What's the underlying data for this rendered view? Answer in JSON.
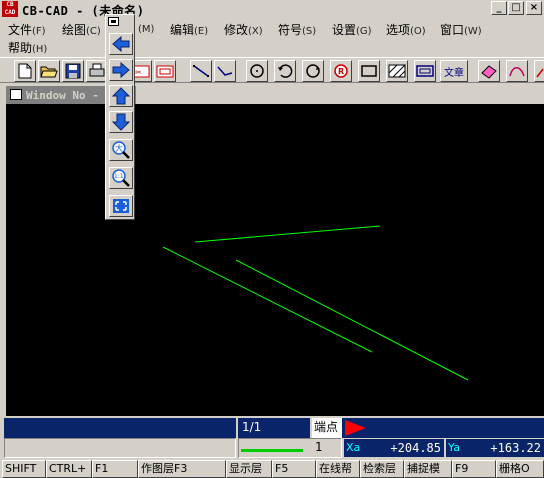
{
  "window": {
    "app_icon_text": "CB CAD",
    "title": "CB-CAD - (未命名)",
    "minimize": "_",
    "maximize": "□",
    "close": "×"
  },
  "menu": {
    "items": [
      {
        "label": "文件",
        "accel": "(F)"
      },
      {
        "label": "绘图",
        "accel": "(C)"
      },
      {
        "label": "",
        "accel": "(M)"
      },
      {
        "label": "编辑",
        "accel": "(E)"
      },
      {
        "label": "修改",
        "accel": "(X)"
      },
      {
        "label": "符号",
        "accel": "(S)"
      },
      {
        "label": "设置",
        "accel": "(G)"
      },
      {
        "label": "选项",
        "accel": "(O)"
      },
      {
        "label": "窗口",
        "accel": "(W)"
      }
    ],
    "help": {
      "label": "帮助",
      "accel": "(H)"
    }
  },
  "toolbar": {
    "icons": [
      "new-file-icon",
      "open-folder-icon",
      "save-disk-icon",
      "polyline-icon",
      "poly-segment-icon",
      "circle-icon",
      "rotate-icon",
      "circle-arrow-icon",
      "registered-circle-icon",
      "rectangle-icon",
      "hatch-icon",
      "frame-icon",
      "text-icon",
      "eraser-icon",
      "curve-icon"
    ],
    "text_button": "文章"
  },
  "float_toolbar": {
    "icons": [
      "arrow-left-icon",
      "arrow-right-icon",
      "arrow-up-icon",
      "arrow-down-icon",
      "zoom-in-icon",
      "zoom-all-icon",
      "fit-screen-icon"
    ],
    "zoom_in_label": "大",
    "zoom_all_label": "1:1"
  },
  "document": {
    "title": "Window No -"
  },
  "drawing": {
    "line_color": "#00ff00",
    "background": "#000000"
  },
  "status": {
    "page": "1/1",
    "snap_label": "端点",
    "layer_number": "1",
    "x_label": "Xa",
    "x_value": "+204.85",
    "y_label": "Ya",
    "y_value": "+163.22"
  },
  "fkeys": [
    {
      "label": "SHIFT"
    },
    {
      "label": "CTRL+"
    },
    {
      "label": "F1"
    },
    {
      "label": "作图层F3"
    },
    {
      "label": "显示层"
    },
    {
      "label": "F5"
    },
    {
      "label": "在线帮"
    },
    {
      "label": "检索层"
    },
    {
      "label": "捕捉模"
    },
    {
      "label": "F9"
    },
    {
      "label": "栅格O"
    }
  ],
  "colors": {
    "face": "#d4d0c8",
    "navy": "#0a246a",
    "inactive_title": "#808080",
    "snap_flag": "#ff0000"
  }
}
